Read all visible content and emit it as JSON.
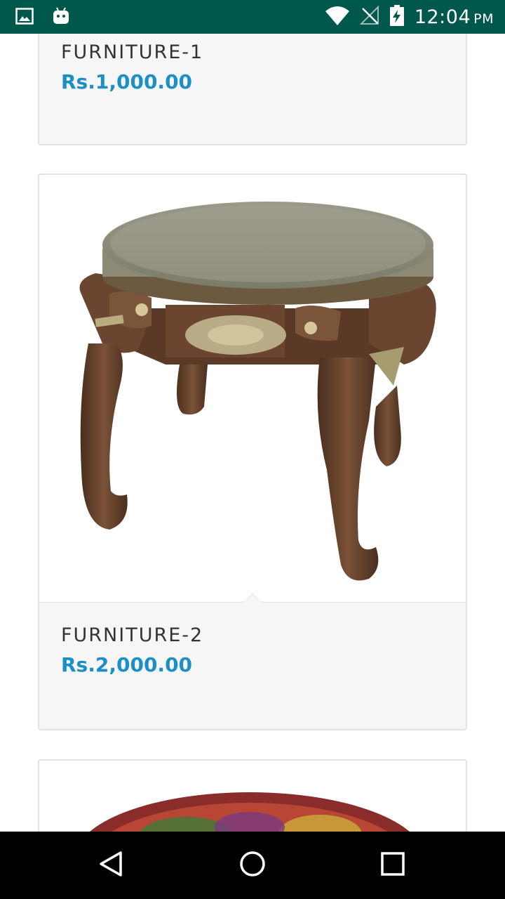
{
  "status_bar": {
    "time": "12:04",
    "ampm": "PM"
  },
  "products": [
    {
      "title": "FURNITURE-1",
      "price": "Rs.1,000.00"
    },
    {
      "title": "FURNITURE-2",
      "price": "Rs.2,000.00"
    },
    {
      "title": "",
      "price": ""
    }
  ],
  "icons": {
    "status_left": [
      "image-notification-icon",
      "android-notification-icon"
    ],
    "status_right": [
      "wifi-icon",
      "no-signal-icon",
      "battery-charging-icon"
    ],
    "nav": [
      "back-icon",
      "home-icon",
      "recents-icon"
    ]
  },
  "colors": {
    "status_bar": "#00574b",
    "price": "#1b8fc6",
    "card_bg": "#f6f6f6"
  }
}
